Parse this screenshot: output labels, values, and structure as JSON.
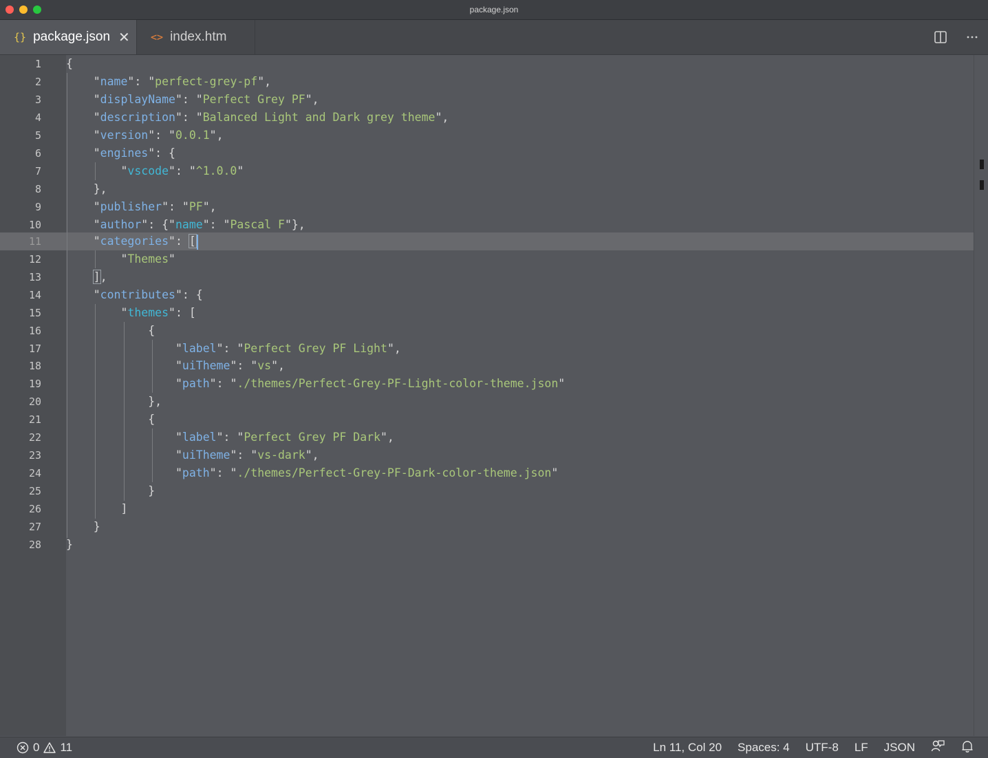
{
  "window": {
    "title": "package.json"
  },
  "tabs": [
    {
      "label": "package.json",
      "icon": "json-braces-icon",
      "icon_glyph": "{}",
      "active": true
    },
    {
      "label": "index.htm",
      "icon": "html-code-icon",
      "icon_glyph": "<>",
      "active": false
    }
  ],
  "editor": {
    "current_line": 11,
    "lines": [
      "1",
      "2",
      "3",
      "4",
      "5",
      "6",
      "7",
      "8",
      "9",
      "10",
      "11",
      "12",
      "13",
      "14",
      "15",
      "16",
      "17",
      "18",
      "19",
      "20",
      "21",
      "22",
      "23",
      "24",
      "25",
      "26",
      "27",
      "28"
    ]
  },
  "code": {
    "name_key": "name",
    "name_val": "perfect-grey-pf",
    "display_key": "displayName",
    "display_val": "Perfect Grey PF",
    "desc_key": "description",
    "desc_val": "Balanced Light and Dark grey theme",
    "version_key": "version",
    "version_val": "0.0.1",
    "engines_key": "engines",
    "vscode_key": "vscode",
    "vscode_val": "^1.0.0",
    "publisher_key": "publisher",
    "publisher_val": "PF",
    "author_key": "author",
    "author_name_key": "name",
    "author_name_val": "Pascal F",
    "categories_key": "categories",
    "categories_item": "Themes",
    "contributes_key": "contributes",
    "themes_key": "themes",
    "label_key": "label",
    "uitheme_key": "uiTheme",
    "path_key": "path",
    "light_label": "Perfect Grey PF Light",
    "light_uitheme": "vs",
    "light_path": "./themes/Perfect-Grey-PF-Light-color-theme.json",
    "dark_label": "Perfect Grey PF Dark",
    "dark_uitheme": "vs-dark",
    "dark_path": "./themes/Perfect-Grey-PF-Dark-color-theme.json"
  },
  "status": {
    "errors": "0",
    "warnings": "11",
    "position": "Ln 11, Col 20",
    "spaces": "Spaces: 4",
    "encoding": "UTF-8",
    "eol": "LF",
    "language": "JSON"
  },
  "colors": {
    "key": "#7fb2e6",
    "nested_key": "#41b8d6",
    "string": "#a9c77a",
    "background": "#55575c"
  }
}
